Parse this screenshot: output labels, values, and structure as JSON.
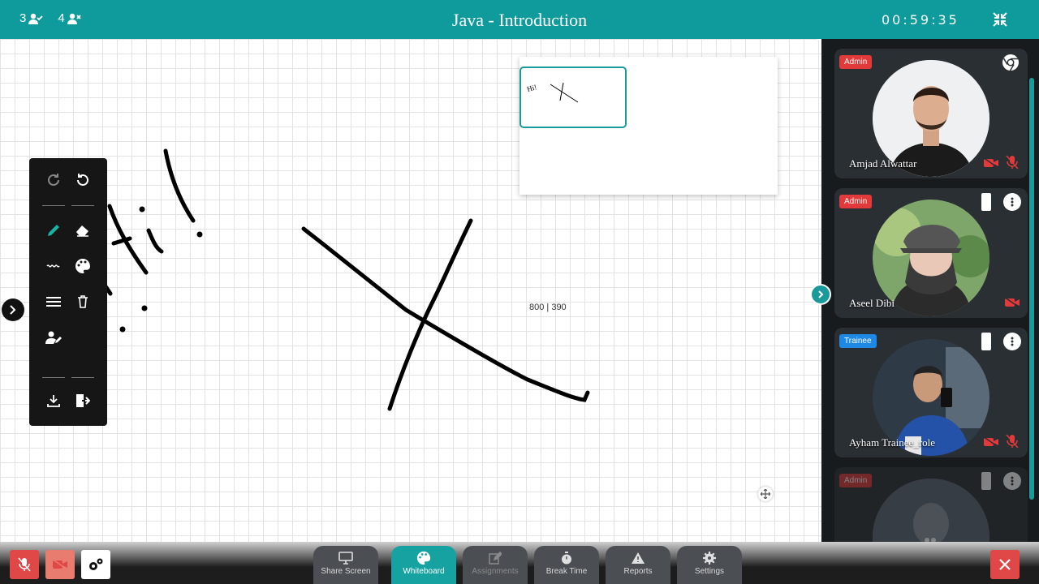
{
  "header": {
    "present_count": "3",
    "absent_count": "4",
    "title": "Java - Introduction",
    "timer": "00:59:35"
  },
  "whiteboard": {
    "coords_readout": "800 | 390",
    "minimap_text": "Hi!",
    "toolbar": [
      {
        "name": "redo"
      },
      {
        "name": "undo"
      },
      {
        "name": "pencil"
      },
      {
        "name": "eraser"
      },
      {
        "name": "line-style"
      },
      {
        "name": "color-palette"
      },
      {
        "name": "stroke-width"
      },
      {
        "name": "delete"
      },
      {
        "name": "user-permissions"
      },
      {
        "name": "download"
      },
      {
        "name": "exit"
      }
    ]
  },
  "participants": [
    {
      "name": "Amjad Alwattar",
      "role": "Admin",
      "camera": "off",
      "mic": "off",
      "browser_icon": "chrome-icon"
    },
    {
      "name": "Aseel Dibi",
      "role": "Admin",
      "camera": "off",
      "device": "mobile"
    },
    {
      "name": "Ayham Trainee_role",
      "role": "Trainee",
      "camera": "off",
      "mic": "off",
      "device": "mobile"
    },
    {
      "name": "",
      "role": "Admin",
      "camera": "off",
      "device": "mobile",
      "faded": true
    }
  ],
  "bottom_tabs": [
    {
      "label": "Share Screen",
      "icon": "monitor-icon",
      "state": "normal"
    },
    {
      "label": "Whiteboard",
      "icon": "palette-icon",
      "state": "active"
    },
    {
      "label": "Assignments",
      "icon": "edit-icon",
      "state": "disabled"
    },
    {
      "label": "Break Time",
      "icon": "stopwatch-icon",
      "state": "normal"
    },
    {
      "label": "Reports",
      "icon": "warning-icon",
      "state": "normal"
    },
    {
      "label": "Settings",
      "icon": "gear-icon",
      "state": "normal"
    }
  ],
  "colors": {
    "brand": "#0f9b9b",
    "active_tab": "#17a2a2",
    "danger": "#e23a3a",
    "trainee_badge": "#1e88e5"
  }
}
